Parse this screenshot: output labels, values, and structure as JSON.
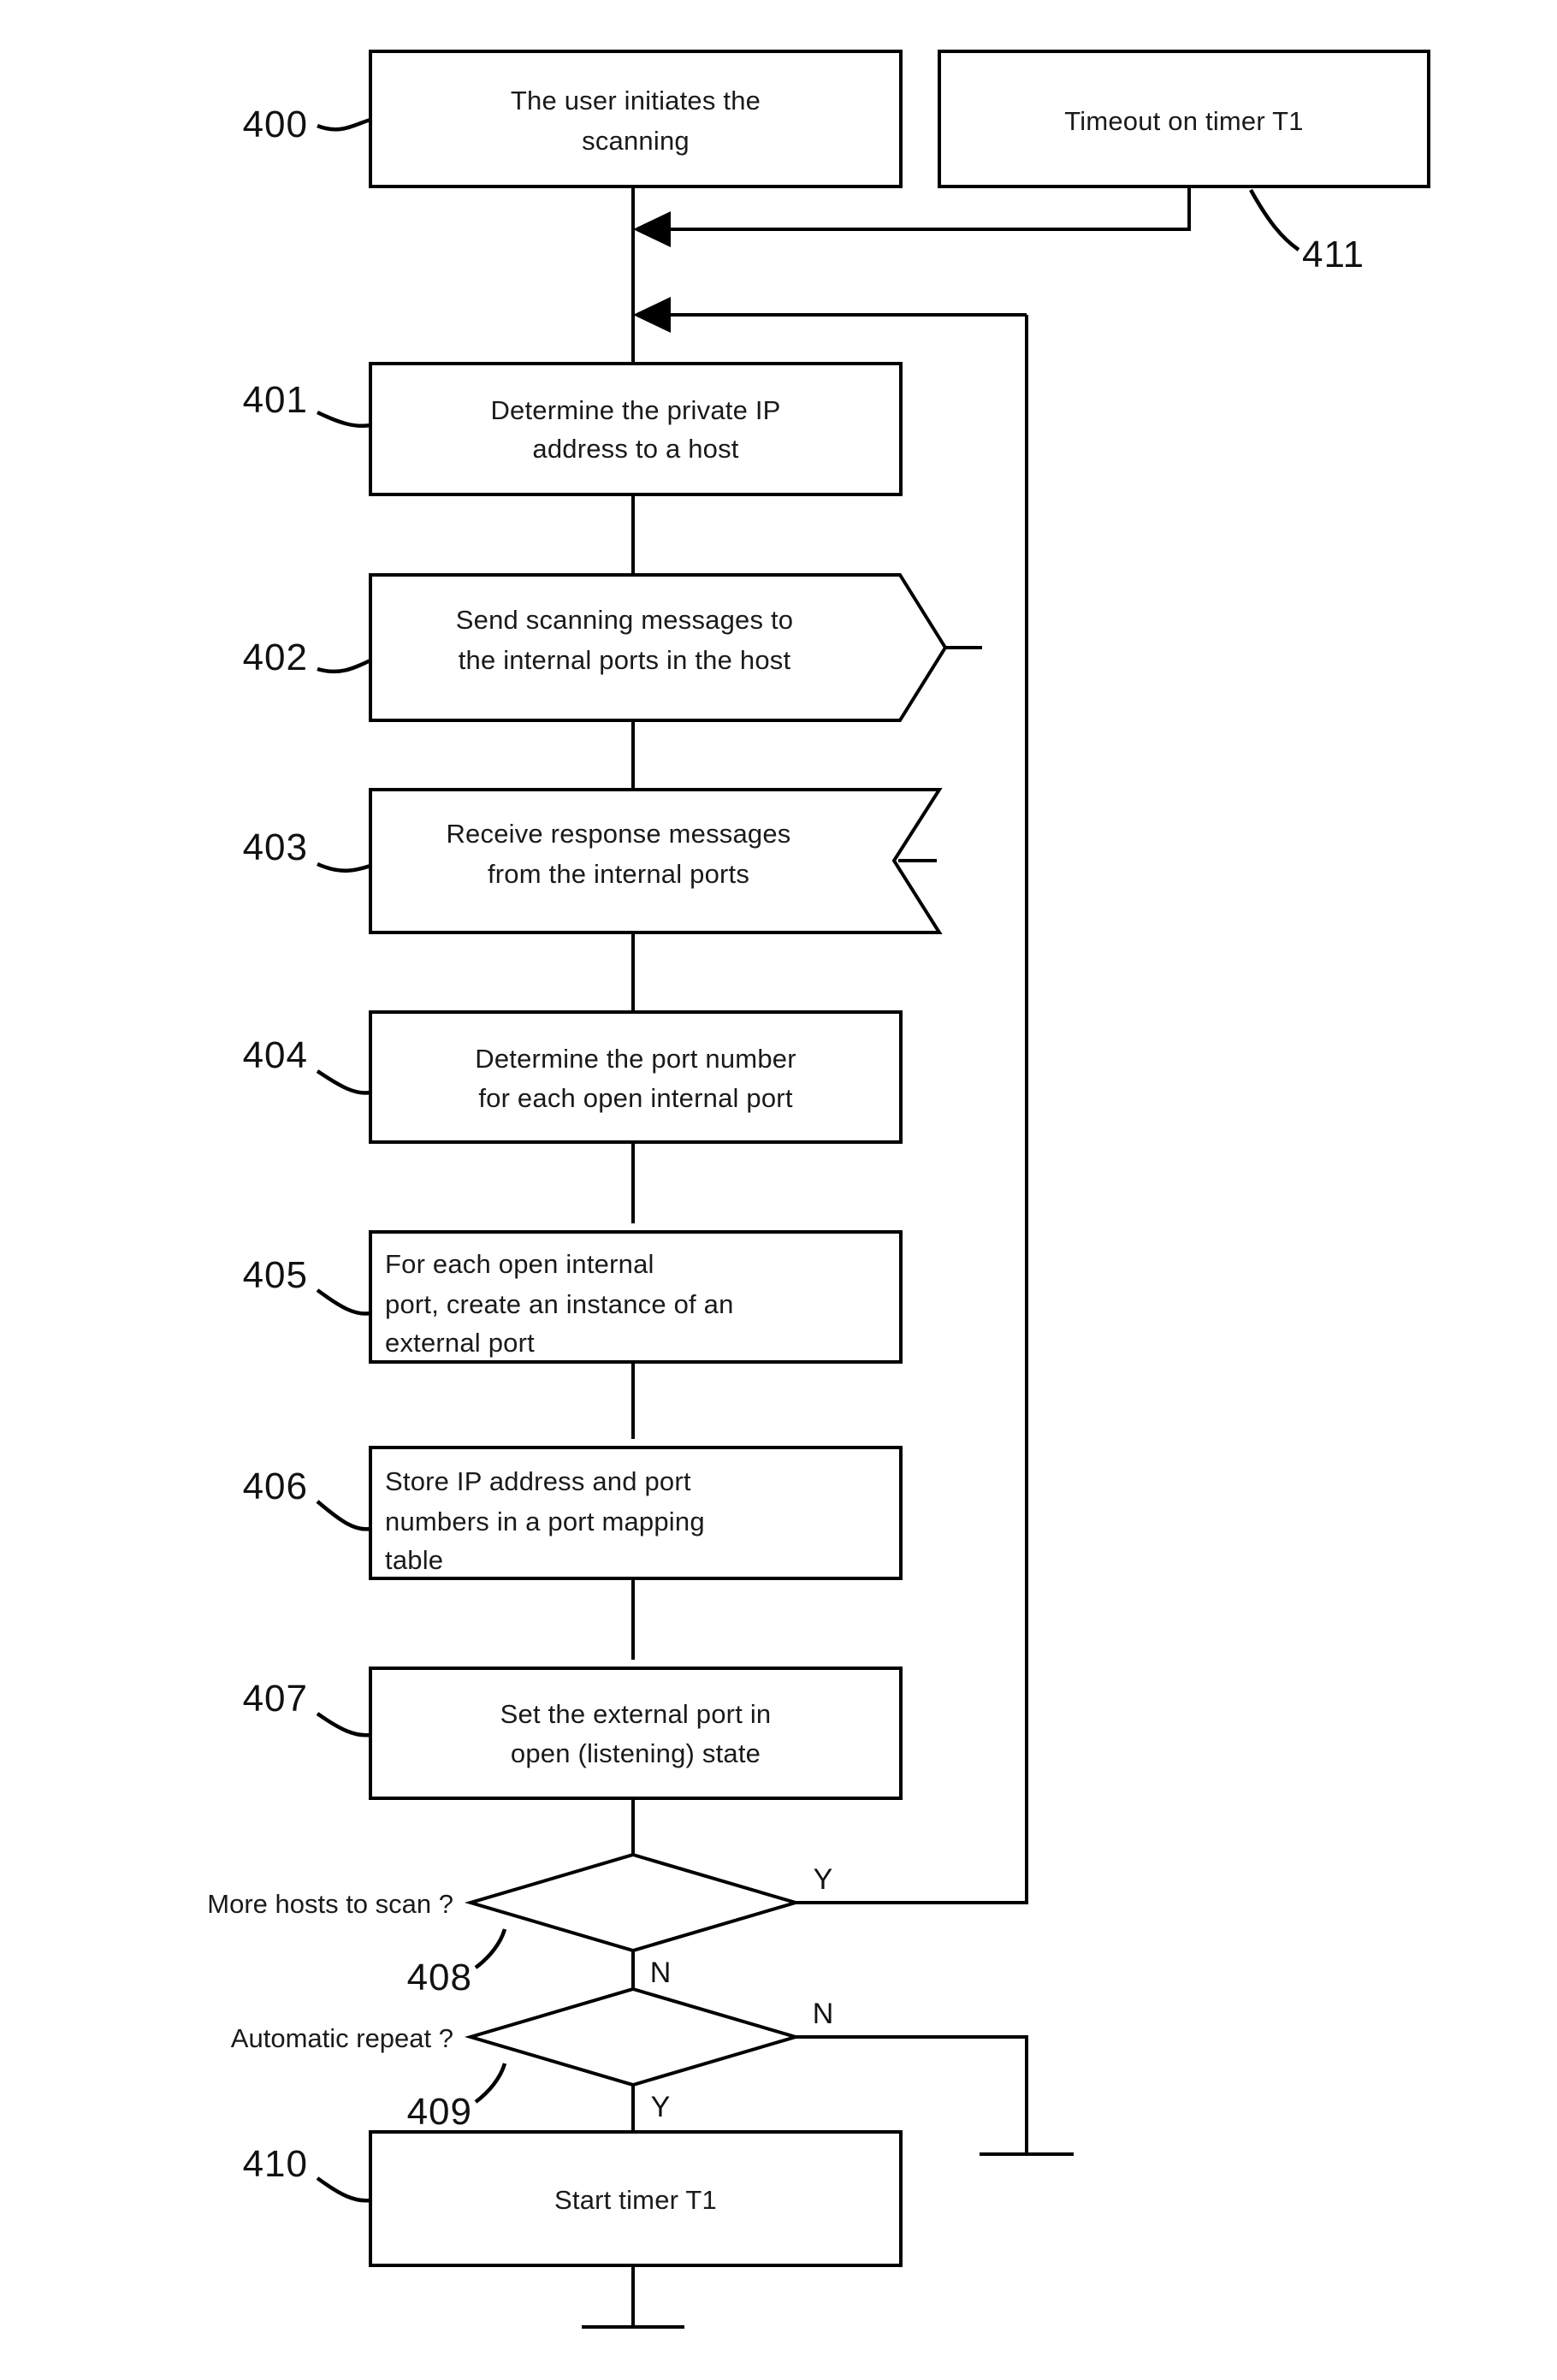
{
  "diagram": {
    "type": "flowchart",
    "title": "Port scanning and mapping process flow",
    "nodes": [
      {
        "ref": "400",
        "shape": "rectangle",
        "lines": [
          "The user initiates the",
          "scanning"
        ],
        "align": "center"
      },
      {
        "ref": "411",
        "shape": "rectangle",
        "lines": [
          "Timeout on timer T1"
        ],
        "align": "center"
      },
      {
        "ref": "401",
        "shape": "rectangle",
        "lines": [
          "Determine the private IP",
          "address to a host"
        ],
        "align": "center"
      },
      {
        "ref": "402",
        "shape": "send-banner",
        "lines": [
          "Send scanning messages to",
          "the internal ports in the host"
        ],
        "align": "center"
      },
      {
        "ref": "403",
        "shape": "receive-banner",
        "lines": [
          "Receive response messages",
          "from the internal ports"
        ],
        "align": "center"
      },
      {
        "ref": "404",
        "shape": "rectangle",
        "lines": [
          "Determine the port number",
          "for each open internal port"
        ],
        "align": "center"
      },
      {
        "ref": "405",
        "shape": "rectangle",
        "lines": [
          "For each open internal",
          "port, create an instance of an",
          "external port"
        ],
        "align": "left"
      },
      {
        "ref": "406",
        "shape": "rectangle",
        "lines": [
          "Store IP address and port",
          "numbers in a port mapping",
          "table"
        ],
        "align": "left"
      },
      {
        "ref": "407",
        "shape": "rectangle",
        "lines": [
          "Set the external port in",
          "open (listening) state"
        ],
        "align": "center"
      },
      {
        "ref": "408",
        "shape": "diamond",
        "lines": [
          "More hosts to scan ?"
        ],
        "align": "right-outside",
        "branch_right": "Y",
        "branch_bottom": "N"
      },
      {
        "ref": "409",
        "shape": "diamond",
        "lines": [
          "Automatic repeat ?"
        ],
        "align": "right-outside",
        "branch_right": "N",
        "branch_bottom": "Y"
      },
      {
        "ref": "410",
        "shape": "rectangle",
        "lines": [
          "Start timer T1"
        ],
        "align": "center"
      }
    ],
    "labels": {
      "n400": "400",
      "n401": "401",
      "n402": "402",
      "n403": "403",
      "n404": "404",
      "n405": "405",
      "n406": "406",
      "n407": "407",
      "n408": "408",
      "n409": "409",
      "n410": "410",
      "n411": "411"
    },
    "text": {
      "t400_l1": "The user initiates the",
      "t400_l2": "scanning",
      "t411_l1": "Timeout on timer T1",
      "t401_l1": "Determine the private IP",
      "t401_l2": "address to a host",
      "t402_l1": "Send scanning messages to",
      "t402_l2": "the internal ports in the host",
      "t403_l1": "Receive response messages",
      "t403_l2": "from the internal ports",
      "t404_l1": "Determine the port number",
      "t404_l2": "for each open internal port",
      "t405_l1": "For each open internal",
      "t405_l2": "port, create an instance of an",
      "t405_l3": "external port",
      "t406_l1": "Store IP address and port",
      "t406_l2": "numbers in a port mapping",
      "t406_l3": "table",
      "t407_l1": "Set the external port in",
      "t407_l2": "open (listening) state",
      "t408_q": "More hosts to scan ?",
      "t409_q": "Automatic repeat ?",
      "t410_l1": "Start timer T1"
    },
    "branches": {
      "b408_y": "Y",
      "b408_n": "N",
      "b409_n": "N",
      "b409_y": "Y"
    },
    "colors": {
      "stroke": "#000000",
      "fill": "#ffffff",
      "text": "#1a1a1a"
    }
  }
}
